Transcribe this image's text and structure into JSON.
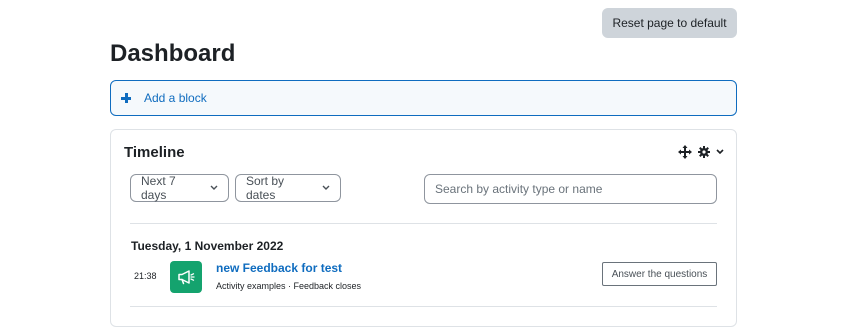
{
  "header": {
    "reset_label": "Reset page to default",
    "page_title": "Dashboard"
  },
  "add_block": {
    "label": "Add a block",
    "icon": "plus-icon"
  },
  "timeline": {
    "title": "Timeline",
    "controls": [
      "move-icon",
      "gear-icon",
      "chevron-down-icon"
    ],
    "filter_days": "Next 7 days",
    "sort_by": "Sort by dates",
    "search_placeholder": "Search by activity type or name",
    "groups": [
      {
        "date": "Tuesday, 1 November 2022",
        "events": [
          {
            "time": "21:38",
            "icon": "megaphone-icon",
            "name": "new Feedback for test",
            "meta": "Activity examples · Feedback closes",
            "action": "Answer the questions"
          }
        ]
      }
    ]
  },
  "colors": {
    "accent": "#0f6cbf",
    "activity_icon_bg": "#14a36e",
    "reset_button_bg": "#ced4da"
  }
}
